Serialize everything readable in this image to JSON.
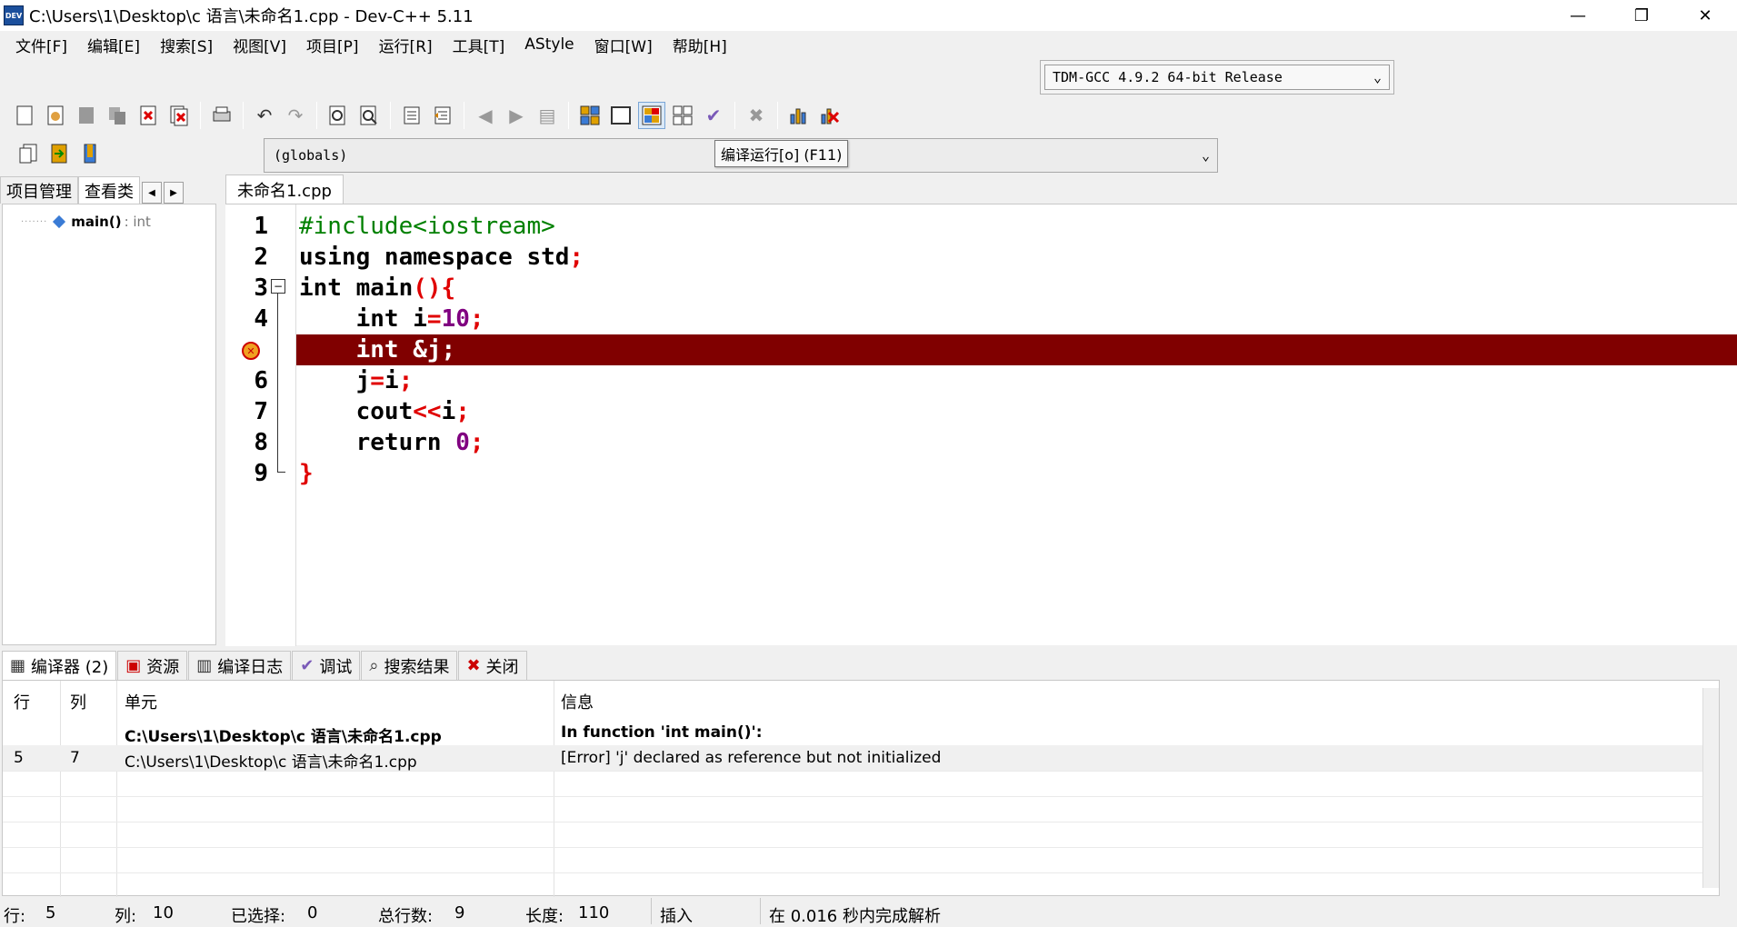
{
  "window": {
    "title": "C:\\Users\\1\\Desktop\\c  语言\\未命名1.cpp - Dev-C++ 5.11",
    "app_icon_text": "DEV",
    "minimize": "—",
    "restore": "❐",
    "close": "✕"
  },
  "menu": [
    "文件[F]",
    "编辑[E]",
    "搜索[S]",
    "视图[V]",
    "项目[P]",
    "运行[R]",
    "工具[T]",
    "AStyle",
    "窗口[W]",
    "帮助[H]"
  ],
  "compiler": {
    "selected": "TDM-GCC 4.9.2 64-bit Release"
  },
  "scope": {
    "selected": "(globals)"
  },
  "tooltip": "编译运行[o] (F11)",
  "left_tabs": [
    "项目管理",
    "查看类"
  ],
  "class_tree": {
    "name": "main",
    "parens": "()",
    "type": ": int"
  },
  "editor": {
    "tab": "未命名1.cpp",
    "line_numbers": [
      "1",
      "2",
      "3",
      "4",
      "5",
      "6",
      "7",
      "8",
      "9"
    ],
    "fold_icon": "−",
    "breakpoint_icon": "✕"
  },
  "bottom_tabs": [
    "编译器 (2)",
    "资源",
    "编译日志",
    "调试",
    "搜索结果",
    "关闭"
  ],
  "messages": {
    "headers": [
      "行",
      "列",
      "单元",
      "信息"
    ],
    "rows": [
      {
        "line": "",
        "col": "",
        "unit": "C:\\Users\\1\\Desktop\\c  语言\\未命名1.cpp",
        "info": "In function 'int main()':"
      },
      {
        "line": "5",
        "col": "7",
        "unit": "C:\\Users\\1\\Desktop\\c  语言\\未命名1.cpp",
        "info": "[Error] 'j' declared as reference but not initialized"
      }
    ]
  },
  "status": {
    "line_label": "行:",
    "line": "5",
    "col_label": "列:",
    "col": "10",
    "sel_label": "已选择:",
    "sel": "0",
    "total_label": "总行数:",
    "total": "9",
    "len_label": "长度:",
    "len": "110",
    "mode": "插入",
    "parse": "在 0.016 秒内完成解析"
  }
}
